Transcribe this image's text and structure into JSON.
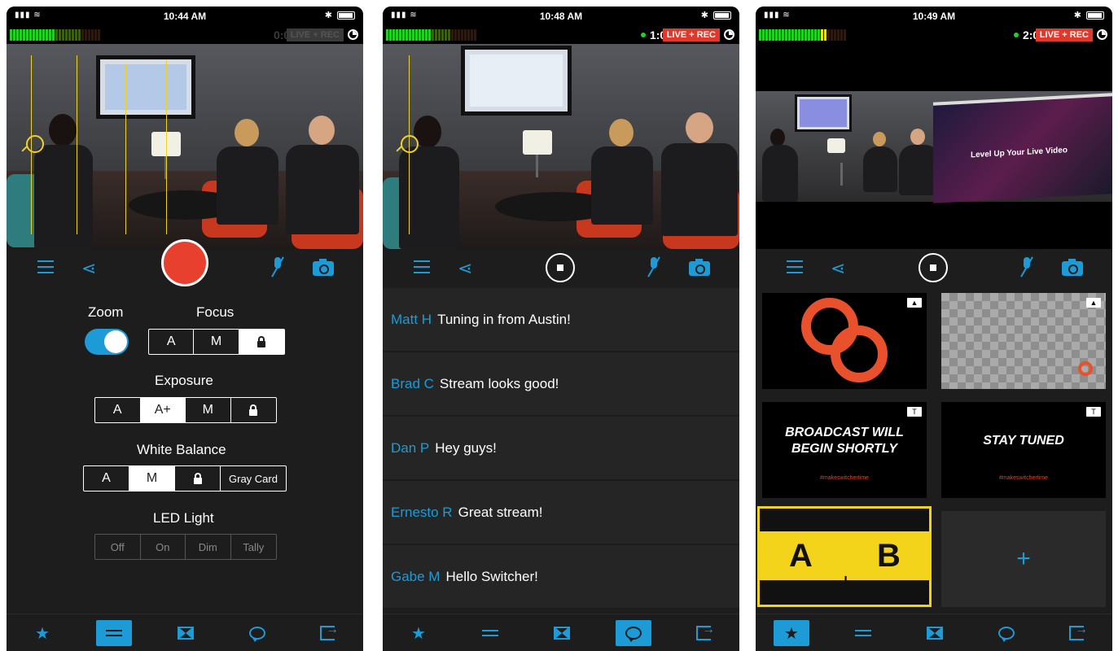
{
  "colors": {
    "accent": "#1c9bd6",
    "record": "#e8402e",
    "live": "#e0392b",
    "meter_green": "#1fd21f",
    "focus_yellow": "#f0d320"
  },
  "screens": [
    {
      "status_time": "10:44 AM",
      "rec_time": "0:00",
      "live_badge": "LIVE + REC",
      "controls": {
        "zoom_label": "Zoom",
        "focus_label": "Focus",
        "focus_options": [
          "A",
          "M",
          "lock-icon"
        ],
        "focus_selected": "lock",
        "exposure_label": "Exposure",
        "exposure_options": [
          "A",
          "A+",
          "M",
          "lock-icon"
        ],
        "exposure_selected": "A+",
        "white_balance_label": "White Balance",
        "wb_options": [
          "A",
          "M",
          "lock-icon",
          "Gray Card"
        ],
        "wb_selected": "M",
        "led_label": "LED Light",
        "led_options": [
          "Off",
          "On",
          "Dim",
          "Tally"
        ]
      },
      "active_tab": "settings"
    },
    {
      "status_time": "10:48 AM",
      "rec_time": "1:04",
      "live_badge": "LIVE + REC",
      "chat": [
        {
          "name": "Matt H",
          "message": "Tuning in from Austin!"
        },
        {
          "name": "Brad C",
          "message": "Stream looks good!"
        },
        {
          "name": "Dan P",
          "message": "Hey guys!"
        },
        {
          "name": "Ernesto R",
          "message": "Great stream!"
        },
        {
          "name": "Gabe M",
          "message": "Hello Switcher!"
        }
      ],
      "active_tab": "comments"
    },
    {
      "status_time": "10:49 AM",
      "rec_time": "2:05",
      "live_badge": "LIVE + REC",
      "overlay_text": "Level Up Your Live Video",
      "tiles": [
        {
          "type": "logo"
        },
        {
          "type": "transparent-logo"
        },
        {
          "type": "title",
          "text_line1": "BROADCAST WILL",
          "text_line2": "BEGIN SHORTLY",
          "hashtag": "#makeswitchertime"
        },
        {
          "type": "title",
          "text_line1": "STAY TUNED",
          "hashtag": "#makeswitchertime"
        },
        {
          "type": "ab",
          "a": "A",
          "b": "B"
        },
        {
          "type": "add",
          "symbol": "+"
        }
      ],
      "active_tab": "favorites"
    }
  ]
}
